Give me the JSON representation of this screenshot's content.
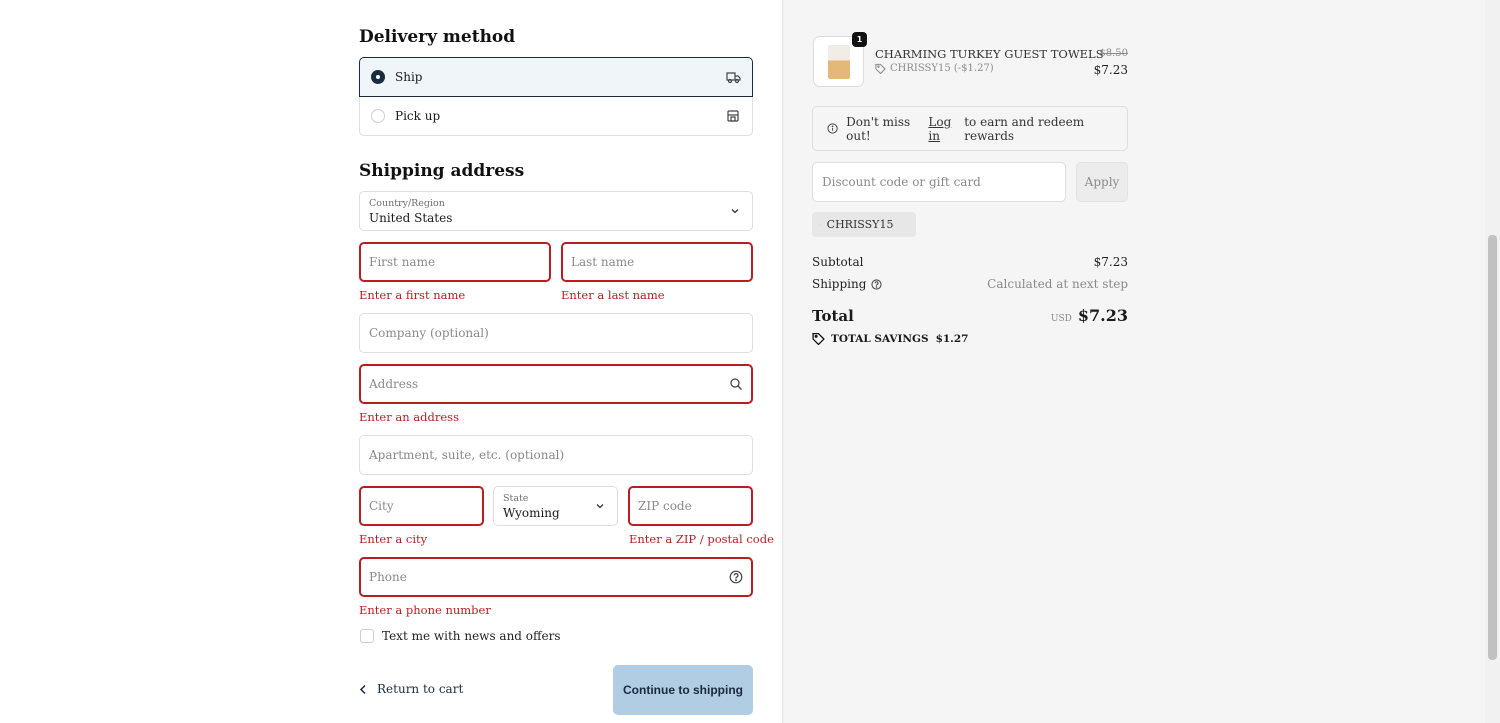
{
  "delivery": {
    "heading": "Delivery method",
    "options": [
      {
        "label": "Ship",
        "icon": "truck-icon",
        "selected": true
      },
      {
        "label": "Pick up",
        "icon": "store-icon",
        "selected": false
      }
    ]
  },
  "shipping": {
    "heading": "Shipping address",
    "country": {
      "label": "Country/Region",
      "value": "United States"
    },
    "first_name": {
      "placeholder": "First name",
      "error": "Enter a first name"
    },
    "last_name": {
      "placeholder": "Last name",
      "error": "Enter a last name"
    },
    "company": {
      "placeholder": "Company (optional)"
    },
    "address": {
      "placeholder": "Address",
      "error": "Enter an address"
    },
    "apartment": {
      "placeholder": "Apartment, suite, etc. (optional)"
    },
    "city": {
      "placeholder": "City",
      "error": "Enter a city"
    },
    "state": {
      "label": "State",
      "value": "Wyoming"
    },
    "zip": {
      "placeholder": "ZIP code",
      "error": "Enter a ZIP / postal code"
    },
    "phone": {
      "placeholder": "Phone",
      "error": "Enter a phone number"
    },
    "news_checkbox": {
      "label": "Text me with news and offers",
      "checked": false
    }
  },
  "footer": {
    "back_label": "Return to cart",
    "continue_label": "Continue to shipping"
  },
  "summary": {
    "item": {
      "quantity": "1",
      "name": "CHARMING TURKEY GUEST TOWELS",
      "discount": "CHRISSY15 (-$1.27)",
      "original_price": "$8.50",
      "price": "$7.23"
    },
    "rewards": {
      "before": "Don't miss out!",
      "link": "Log in",
      "after": "to earn and redeem rewards"
    },
    "discount_field": {
      "placeholder": "Discount code or gift card"
    },
    "apply_label": "Apply",
    "applied_code": "CHRISSY15",
    "subtotal_label": "Subtotal",
    "subtotal_value": "$7.23",
    "shipping_label": "Shipping",
    "shipping_value": "Calculated at next step",
    "total_label": "Total",
    "currency": "USD",
    "total_value": "$7.23",
    "savings_label": "TOTAL SAVINGS",
    "savings_value": "$1.27"
  },
  "colors": {
    "error": "#b81d24",
    "primary_button": "#b1cde3",
    "selected_border": "#1b2c3f"
  }
}
